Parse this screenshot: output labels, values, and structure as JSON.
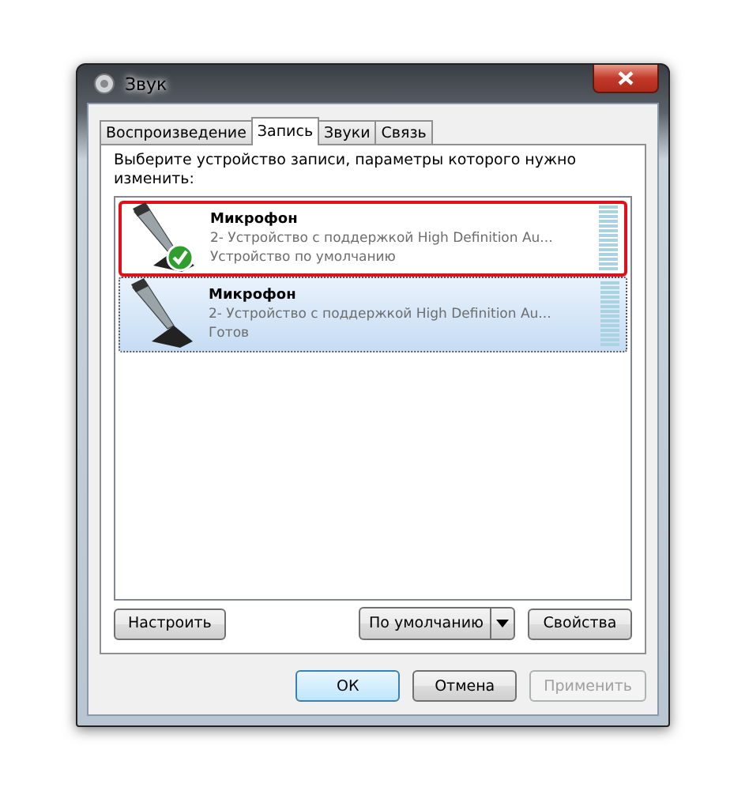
{
  "window": {
    "title": "Звук"
  },
  "tabs": [
    {
      "label": "Воспроизведение",
      "selected": false
    },
    {
      "label": "Запись",
      "selected": true
    },
    {
      "label": "Звуки",
      "selected": false
    },
    {
      "label": "Связь",
      "selected": false
    }
  ],
  "instruction": "Выберите устройство записи, параметры которого нужно изменить:",
  "devices": [
    {
      "name": "Микрофон",
      "description": "2- Устройство с поддержкой High Definition Au...",
      "status": "Устройство по умолчанию",
      "default": true,
      "selected": false,
      "highlighted": true
    },
    {
      "name": "Микрофон",
      "description": "2- Устройство с поддержкой High Definition Au...",
      "status": "Готов",
      "default": false,
      "selected": true,
      "highlighted": false
    }
  ],
  "panel_buttons": {
    "configure": "Настроить",
    "set_default": "По умолчанию",
    "properties": "Свойства"
  },
  "dialog_buttons": [
    {
      "label": "ОК",
      "kind": "default",
      "disabled": false
    },
    {
      "label": "Отмена",
      "kind": "normal",
      "disabled": false
    },
    {
      "label": "Применить",
      "kind": "normal",
      "disabled": true
    }
  ]
}
